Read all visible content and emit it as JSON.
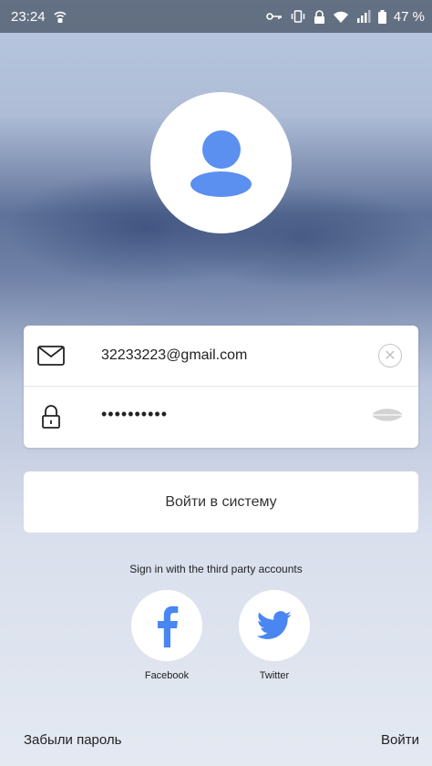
{
  "status_bar": {
    "time": "23:24",
    "battery": "47 %",
    "icons": [
      "wifi-hotspot-icon",
      "vpn-key-icon",
      "vibrate-icon",
      "lock-icon",
      "wifi-icon",
      "signal-icon",
      "battery-icon"
    ]
  },
  "form": {
    "email_value": "32233223@gmail.com",
    "password_value": "••••••••••",
    "email_icon": "mail-icon",
    "password_icon": "lock-icon",
    "clear_icon": "clear-icon",
    "toggle_icon": "eye-icon"
  },
  "login_button_label": "Войти в систему",
  "third_party": {
    "label": "Sign in with the third party accounts",
    "facebook_label": "Facebook",
    "twitter_label": "Twitter"
  },
  "footer": {
    "forgot_label": "Забыли пароль",
    "signin_label": "Войти"
  },
  "colors": {
    "accent": "#5b8ff0"
  }
}
